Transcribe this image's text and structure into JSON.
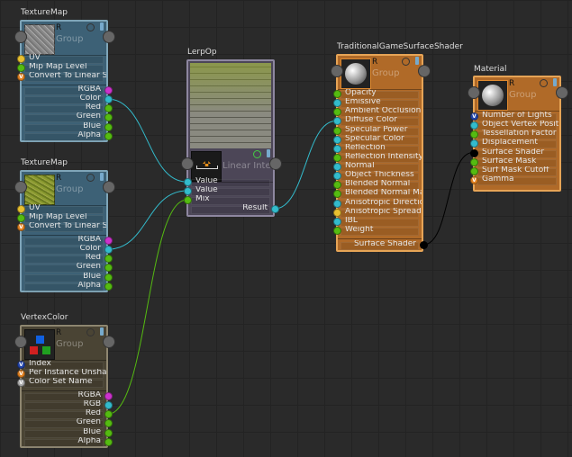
{
  "colors": {
    "float": "#55bb11",
    "color": "#33bbcc",
    "rgba": "#cc33cc",
    "yellow": "#e8c030",
    "shader": "#000000",
    "enum": "#e08020",
    "int": "#2244aa",
    "string": "#aaaaaa"
  },
  "nodes": [
    {
      "id": "tex1",
      "title": "TextureMap",
      "header": {
        "r": "R",
        "group": "Group"
      },
      "theme": "tex",
      "thumb": "noise",
      "inputs": [
        {
          "label": "UV",
          "type": "yellow"
        },
        {
          "label": "Mip Map Level",
          "type": "float"
        },
        {
          "label": "Convert To Linear Space",
          "type": "enum",
          "glyph": "V"
        }
      ],
      "outputs": [
        {
          "label": "RGBA",
          "type": "rgba"
        },
        {
          "label": "Color",
          "type": "color"
        },
        {
          "label": "Red",
          "type": "float"
        },
        {
          "label": "Green",
          "type": "float"
        },
        {
          "label": "Blue",
          "type": "float"
        },
        {
          "label": "Alpha",
          "type": "float"
        }
      ]
    },
    {
      "id": "tex2",
      "title": "TextureMap",
      "header": {
        "r": "R",
        "group": "Group"
      },
      "theme": "tex",
      "thumb": "moss",
      "inputs": [
        {
          "label": "UV",
          "type": "yellow"
        },
        {
          "label": "Mip Map Level",
          "type": "float"
        },
        {
          "label": "Convert To Linear Space",
          "type": "enum",
          "glyph": "V"
        }
      ],
      "outputs": [
        {
          "label": "RGBA",
          "type": "rgba"
        },
        {
          "label": "Color",
          "type": "color"
        },
        {
          "label": "Red",
          "type": "float"
        },
        {
          "label": "Green",
          "type": "float"
        },
        {
          "label": "Blue",
          "type": "float"
        },
        {
          "label": "Alpha",
          "type": "float"
        }
      ]
    },
    {
      "id": "vc",
      "title": "VertexColor",
      "header": {
        "r": "R",
        "group": "Group"
      },
      "theme": "vc",
      "thumb": "rgb",
      "inputs": [
        {
          "label": "Index",
          "type": "int",
          "glyph": "V"
        },
        {
          "label": "Per Instance Unshared",
          "type": "enum",
          "glyph": "V"
        },
        {
          "label": "Color Set Name",
          "type": "string",
          "glyph": "V"
        }
      ],
      "outputs": [
        {
          "label": "RGBA",
          "type": "rgba"
        },
        {
          "label": "RGB",
          "type": "color"
        },
        {
          "label": "Red",
          "type": "float"
        },
        {
          "label": "Green",
          "type": "float"
        },
        {
          "label": "Blue",
          "type": "float"
        },
        {
          "label": "Alpha",
          "type": "float"
        }
      ]
    },
    {
      "id": "lerp",
      "title": "LerpOp",
      "header": {
        "group": "Linear Interpolation"
      },
      "theme": "lerp",
      "thumb": "lerp",
      "inputs": [
        {
          "label": "Value",
          "type": "color"
        },
        {
          "label": "Value",
          "type": "color"
        },
        {
          "label": "Mix",
          "type": "float"
        }
      ],
      "outputs": [
        {
          "label": "Result",
          "type": "color"
        }
      ]
    },
    {
      "id": "tgs",
      "title": "TraditionalGameSurfaceShader",
      "header": {
        "r": "R",
        "group": "Group"
      },
      "theme": "orange",
      "thumb": "sphere",
      "inputs": [
        {
          "label": "Opacity",
          "type": "float"
        },
        {
          "label": "Emissive",
          "type": "color"
        },
        {
          "label": "Ambient Occlusion",
          "type": "float"
        },
        {
          "label": "Diffuse Color",
          "type": "color"
        },
        {
          "label": "Specular Power",
          "type": "float"
        },
        {
          "label": "Specular Color",
          "type": "color"
        },
        {
          "label": "Reflection",
          "type": "color"
        },
        {
          "label": "Reflection Intensity",
          "type": "float"
        },
        {
          "label": "Normal",
          "type": "color"
        },
        {
          "label": "Object Thickness",
          "type": "color"
        },
        {
          "label": "Blended Normal",
          "type": "float"
        },
        {
          "label": "Blended Normal Mask",
          "type": "float"
        },
        {
          "label": "Anisotropic Direction",
          "type": "color"
        },
        {
          "label": "Anisotropic Spread",
          "type": "yellow"
        },
        {
          "label": "IBL",
          "type": "color"
        },
        {
          "label": "Weight",
          "type": "float"
        }
      ],
      "outputs": [
        {
          "label": "Surface Shader",
          "type": "shader"
        }
      ]
    },
    {
      "id": "mat",
      "title": "Material",
      "header": {
        "r": "R",
        "group": "Group"
      },
      "theme": "orange",
      "thumb": "sphere",
      "inputs": [
        {
          "label": "Number of Lights",
          "type": "int",
          "glyph": "V"
        },
        {
          "label": "Object Vertex Position",
          "type": "color"
        },
        {
          "label": "Tessellation Factor",
          "type": "float"
        },
        {
          "label": "Displacement",
          "type": "color"
        },
        {
          "label": "Surface Shader",
          "type": "shader"
        },
        {
          "label": "Surface Mask",
          "type": "float"
        },
        {
          "label": "Surf Mask Cutoff",
          "type": "float"
        },
        {
          "label": "Gamma",
          "type": "enum",
          "glyph": "V"
        }
      ],
      "outputs": []
    }
  ],
  "connections": [
    {
      "from": "tex1.Color",
      "to": "lerp.Value#1",
      "color": "#33bbcc"
    },
    {
      "from": "tex2.Color",
      "to": "lerp.Value#2",
      "color": "#33bbcc"
    },
    {
      "from": "vc.Red",
      "to": "lerp.Mix",
      "color": "#55bb11"
    },
    {
      "from": "lerp.Result",
      "to": "tgs.Diffuse Color",
      "color": "#33bbcc"
    },
    {
      "from": "tgs.Surface Shader",
      "to": "mat.Surface Shader",
      "color": "#000000"
    }
  ]
}
